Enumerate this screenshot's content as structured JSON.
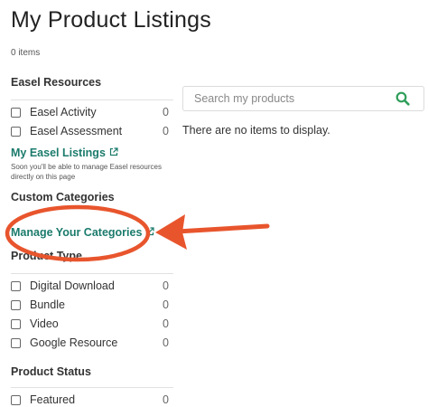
{
  "page": {
    "title": "My Product Listings",
    "item_count": "0 items",
    "empty_message": "There are no items to display."
  },
  "search": {
    "placeholder": "Search my products"
  },
  "sidebar": {
    "easel": {
      "heading": "Easel Resources",
      "items": [
        {
          "label": "Easel Activity",
          "count": "0"
        },
        {
          "label": "Easel Assessment",
          "count": "0"
        }
      ],
      "link": "My Easel Listings",
      "note": "Soon you'll be able to manage Easel resources directly on this page"
    },
    "custom": {
      "heading": "Custom Categories",
      "link": "Manage Your Categories"
    },
    "product_type": {
      "heading": "Product Type",
      "items": [
        {
          "label": "Digital Download",
          "count": "0"
        },
        {
          "label": "Bundle",
          "count": "0"
        },
        {
          "label": "Video",
          "count": "0"
        },
        {
          "label": "Google Resource",
          "count": "0"
        }
      ]
    },
    "product_status": {
      "heading": "Product Status",
      "items": [
        {
          "label": "Featured",
          "count": "0"
        }
      ]
    }
  },
  "colors": {
    "link": "#1b7b6c",
    "search_icon": "#2e9e59",
    "annotation": "#e8552d"
  },
  "icons": [
    "external-link-icon",
    "search-icon",
    "checkbox-icon"
  ]
}
